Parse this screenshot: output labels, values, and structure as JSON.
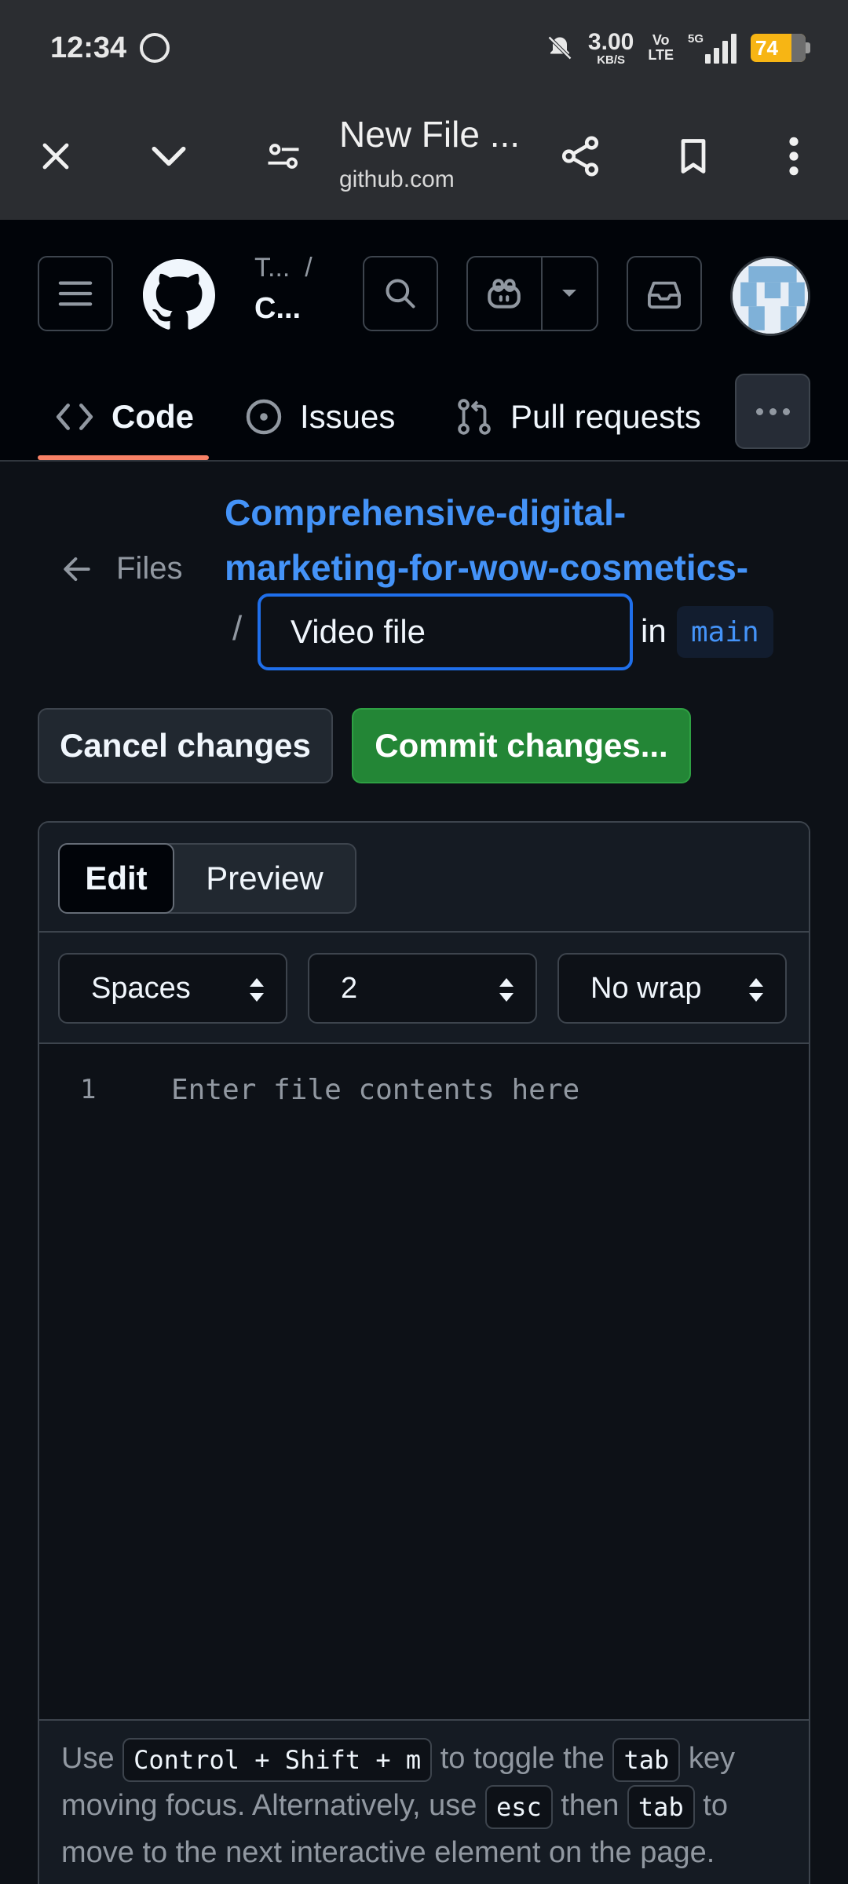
{
  "status_bar": {
    "time": "12:34",
    "speed_value": "3.00",
    "speed_unit": "KB/S",
    "volte_top": "Vo",
    "volte_bottom": "LTE",
    "network": "5G",
    "battery": "74"
  },
  "browser": {
    "title": "New File ...",
    "url": "github.com",
    "icons": [
      "close-icon",
      "chevron-down-icon",
      "page-settings-icon",
      "share-icon",
      "bookmark-icon",
      "more-vert-icon"
    ]
  },
  "github_header": {
    "owner": "T...",
    "owner_sep": "/",
    "repo": "C...",
    "tabs": [
      {
        "label": "Code",
        "icon": "code-icon"
      },
      {
        "label": "Issues",
        "icon": "issue-icon"
      },
      {
        "label": "Pull requests",
        "icon": "pull-request-icon"
      }
    ]
  },
  "file_path": {
    "back_label": "Files",
    "repo_line1": "Comprehensive-digital-",
    "repo_line2": "marketing-for-wow-cosmetics-",
    "slash": "/",
    "filename_value": "Video file",
    "in_label": "in",
    "branch": "main"
  },
  "actions": {
    "cancel_label": "Cancel changes",
    "commit_label": "Commit changes..."
  },
  "editor": {
    "tab_edit": "Edit",
    "tab_preview": "Preview",
    "indent_mode": "Spaces",
    "indent_size": "2",
    "wrap_mode": "No wrap",
    "line_number": "1",
    "placeholder": "Enter file contents here",
    "hint": {
      "use": "Use",
      "shortcut": "Control + Shift + m",
      "toggle_text": "to toggle the",
      "tab_key": "tab",
      "key_moving": "key moving focus. Alternatively, use",
      "esc_key": "esc",
      "then": "then",
      "tab_key2": "tab",
      "to_move": "to move to the next interactive element on the page."
    }
  },
  "colors": {
    "accent_link": "#4493f8",
    "commit_green": "#238636",
    "tab_underline": "#f78166",
    "battery": "#f7b514"
  }
}
